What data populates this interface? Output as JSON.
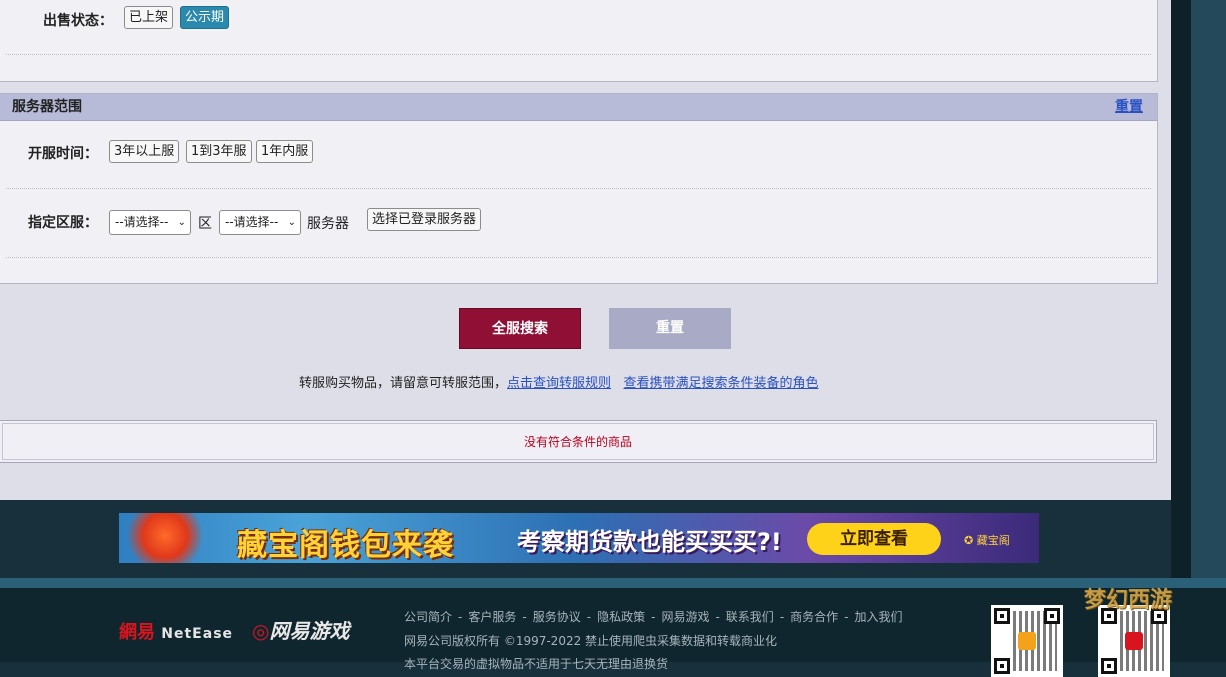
{
  "filters": {
    "sale_status_label": "出售状态：",
    "sale_status_options": [
      "已上架",
      "公示期"
    ],
    "active_status": "公示期"
  },
  "server_range": {
    "title": "服务器范围",
    "reset_label": "重置",
    "open_time_label": "开服时间：",
    "open_time_options": [
      "3年以上服",
      "1到3年服",
      "1年内服"
    ],
    "zone_label": "指定区服：",
    "zone_select_value": "--请选择--",
    "zone_unit": "区",
    "server_select_value": "--请选择--",
    "server_unit": "服务器",
    "choose_logged_server": "选择已登录服务器"
  },
  "actions": {
    "search_all_label": "全服搜索",
    "reset_label": "重置"
  },
  "notice": {
    "text": "转服购买物品，请留意可转服范围，",
    "link_rules": "点击查询转服规则",
    "link_roles": "查看携带满足搜索条件装备的角色"
  },
  "results": {
    "empty_text": "没有符合条件的商品"
  },
  "banner": {
    "headline": "藏宝阁钱包来袭",
    "subline": "考察期货款也能买买买?!",
    "cta": "立即查看",
    "brand": "藏宝阁"
  },
  "footer": {
    "logo_netease_cn": "網易",
    "logo_netease_en": "NetEase",
    "logo_games": "网易游戏",
    "links": [
      "公司简介",
      "客户服务",
      "服务协议",
      "隐私政策",
      "网易游戏",
      "联系我们",
      "商务合作",
      "加入我们"
    ],
    "copyright": "网易公司版权所有 ©1997-2022 禁止使用爬虫采集数据和转载商业化",
    "copyright_line2": "本平台交易的虚拟物品不适用于七天无理由退换货",
    "corner_logo": "梦幻西游"
  },
  "colors": {
    "accent_blue": "#2a89ad",
    "search_button": "#8f0f35",
    "reset_button": "#a9abc6",
    "link": "#2a51c2",
    "empty_text": "#b8001c"
  }
}
